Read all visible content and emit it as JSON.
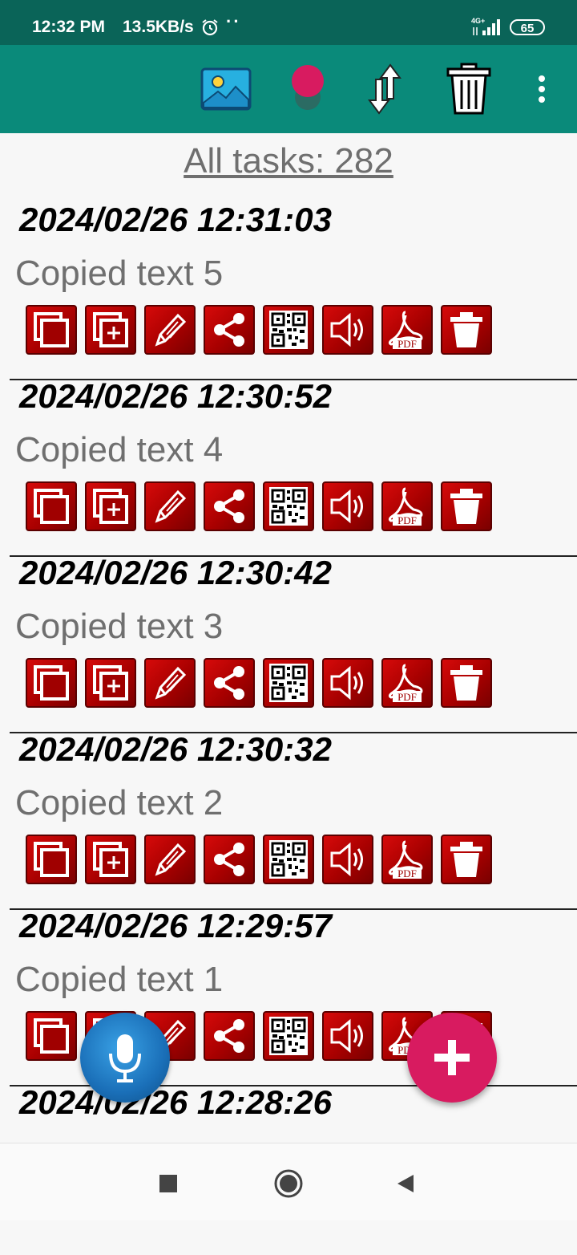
{
  "status_bar": {
    "time": "12:32 PM",
    "speed": "13.5KB/s",
    "dots": "··",
    "network_label": "4G+",
    "battery": "65"
  },
  "app_bar": {
    "icons": [
      "image-icon",
      "color-dot-icon",
      "sort-arrows-icon",
      "trash-icon",
      "overflow-menu-icon"
    ]
  },
  "header": {
    "all_tasks": "All tasks: 282"
  },
  "tasks": [
    {
      "date": "2024/02/26 12:31:03",
      "text": "Copied text 5"
    },
    {
      "date": "2024/02/26 12:30:52",
      "text": "Copied text 4"
    },
    {
      "date": "2024/02/26 12:30:42",
      "text": "Copied text 3"
    },
    {
      "date": "2024/02/26 12:30:32",
      "text": "Copied text 2"
    },
    {
      "date": "2024/02/26 12:29:57",
      "text": "Copied text 1"
    },
    {
      "date": "2024/02/26 12:28:26",
      "text": ""
    }
  ],
  "task_actions": [
    "copy-icon",
    "copy-add-icon",
    "edit-pencil-icon",
    "share-icon",
    "qr-code-icon",
    "speaker-icon",
    "pdf-icon",
    "delete-icon"
  ],
  "pdf_label": "PDF",
  "colors": {
    "status_bar": "#0a6458",
    "app_bar": "#0a8a7a",
    "action_red": "#c00000",
    "fab_pink": "#d81b60",
    "mic_blue": "#1a6fb8"
  }
}
